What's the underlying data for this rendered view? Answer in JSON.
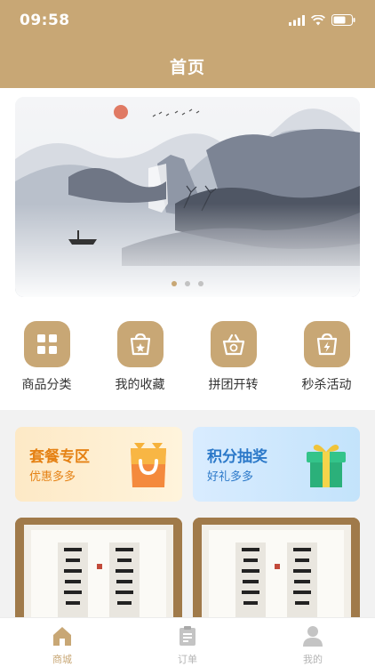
{
  "status_bar": {
    "time": "09:58"
  },
  "header": {
    "title": "首页"
  },
  "banner": {
    "dots": 3,
    "active_dot": 0
  },
  "quick_links": [
    {
      "label": "商品分类",
      "icon": "grid-icon"
    },
    {
      "label": "我的收藏",
      "icon": "favorite-bag-icon"
    },
    {
      "label": "拼团开转",
      "icon": "group-basket-icon"
    },
    {
      "label": "秒杀活动",
      "icon": "flash-bag-icon"
    }
  ],
  "promos": [
    {
      "title": "套餐专区",
      "subtitle": "优惠多多",
      "icon": "shopping-bag-icon"
    },
    {
      "title": "积分抽奖",
      "subtitle": "好礼多多",
      "icon": "gift-box-icon"
    }
  ],
  "tabs": [
    {
      "label": "商城",
      "icon": "home-icon",
      "active": true
    },
    {
      "label": "订单",
      "icon": "order-icon",
      "active": false
    },
    {
      "label": "我的",
      "icon": "profile-icon",
      "active": false
    }
  ],
  "colors": {
    "brand": "#c8a775",
    "promo_orange": "#e58215",
    "promo_blue": "#2c79c9"
  }
}
